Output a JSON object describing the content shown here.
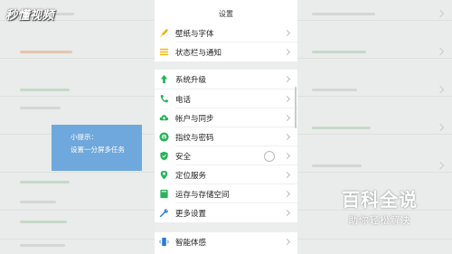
{
  "logo": {
    "text": "秒懂视频"
  },
  "settings": {
    "header": "设置",
    "items": [
      {
        "label": "壁纸与字体",
        "icon": "brush-icon",
        "color": "#f5b400"
      },
      {
        "label": "状态栏与通知",
        "icon": "menu-lines-icon",
        "color": "#f5b400"
      },
      {
        "label": "系统升级",
        "icon": "upgrade-arrow-icon",
        "color": "#27b35a"
      },
      {
        "label": "电话",
        "icon": "phone-icon",
        "color": "#27b35a"
      },
      {
        "label": "帐户与同步",
        "icon": "cloud-sync-icon",
        "color": "#27b35a"
      },
      {
        "label": "指纹与密码",
        "icon": "fingerprint-icon",
        "color": "#27b35a"
      },
      {
        "label": "安全",
        "icon": "shield-icon",
        "color": "#27b35a"
      },
      {
        "label": "定位服务",
        "icon": "location-pin-icon",
        "color": "#27b35a"
      },
      {
        "label": "运存与存储空间",
        "icon": "storage-icon",
        "color": "#27b35a"
      },
      {
        "label": "更多设置",
        "icon": "wrench-icon",
        "color": "#2b7bd8"
      },
      {
        "label": "智能体感",
        "icon": "motion-sense-icon",
        "color": "#2b7bd8"
      }
    ]
  },
  "tip": {
    "title": "小提示：",
    "text": "设置一分屏多任务"
  },
  "watermark": {
    "main": "百科全说",
    "sub": "助你轻松解决"
  },
  "colors": {
    "tip_bg": "#6fa8dc",
    "green": "#27b35a",
    "blue": "#2b7bd8",
    "yellow": "#f5b400"
  }
}
